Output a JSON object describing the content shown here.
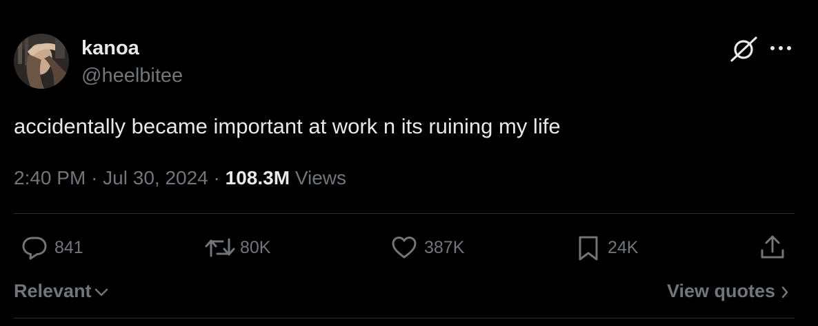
{
  "author": {
    "display_name": "kanoa",
    "handle": "@heelbitee"
  },
  "tweet": {
    "text": "accidentally became important at work n its ruining my life",
    "time": "2:40 PM",
    "date": "Jul 30, 2024",
    "views_count": "108.3M",
    "views_label": "Views",
    "separator": "·"
  },
  "actions": {
    "replies": "841",
    "reposts": "80K",
    "likes": "387K",
    "bookmarks": "24K"
  },
  "footer": {
    "sort_label": "Relevant",
    "quotes_label": "View quotes"
  },
  "icons": {
    "top": [
      "grok-icon",
      "more-icon"
    ],
    "actions": [
      "reply-icon",
      "repost-icon",
      "like-icon",
      "bookmark-icon",
      "share-icon"
    ]
  },
  "colors": {
    "background": "#000000",
    "primary_text": "#e7e9ea",
    "secondary_text": "#71767b",
    "divider": "#2f3336"
  }
}
